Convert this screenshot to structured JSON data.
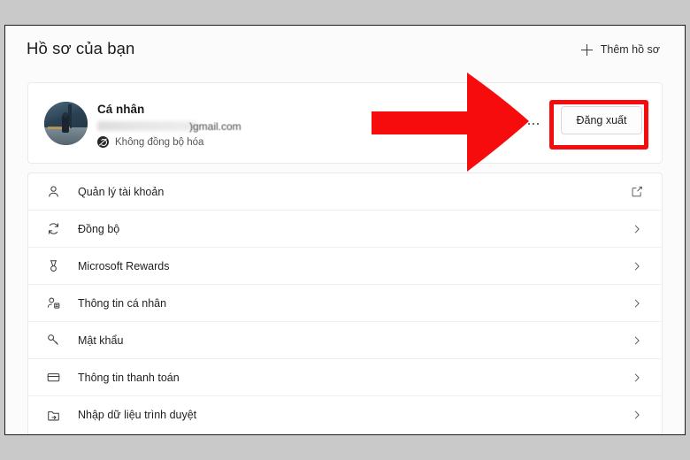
{
  "header": {
    "title": "Hồ sơ của bạn",
    "add_profile_label": "Thêm hồ sơ",
    "add_profile_icon": "plus-icon"
  },
  "profile": {
    "name": "Cá nhân",
    "email_suffix": ")gmail.com",
    "email_redacted": true,
    "sync_status": "Không đồng bộ hóa",
    "sync_icon": "sync-off-icon",
    "avatar_icon": "user-avatar-photo",
    "more_options_icon": "ellipsis-icon",
    "signout_label": "Đăng xuất"
  },
  "list": {
    "items": [
      {
        "label": "Quản lý tài khoản",
        "icon": "person-icon",
        "trailing": "external-link-icon"
      },
      {
        "label": "Đồng bộ",
        "icon": "sync-icon",
        "trailing": "chevron-right-icon"
      },
      {
        "label": "Microsoft Rewards",
        "icon": "medal-icon",
        "trailing": "chevron-right-icon"
      },
      {
        "label": "Thông tin cá nhân",
        "icon": "person-card-icon",
        "trailing": "chevron-right-icon"
      },
      {
        "label": "Mật khẩu",
        "icon": "key-icon",
        "trailing": "chevron-right-icon"
      },
      {
        "label": "Thông tin thanh toán",
        "icon": "credit-card-icon",
        "trailing": "chevron-right-icon"
      },
      {
        "label": "Nhập dữ liệu trình duyệt",
        "icon": "import-folder-icon",
        "trailing": "chevron-right-icon"
      }
    ]
  },
  "annotations": {
    "highlight_color": "#f60c0c",
    "arrow_icon": "red-arrow-right",
    "highlight_target": "Đăng xuất"
  }
}
